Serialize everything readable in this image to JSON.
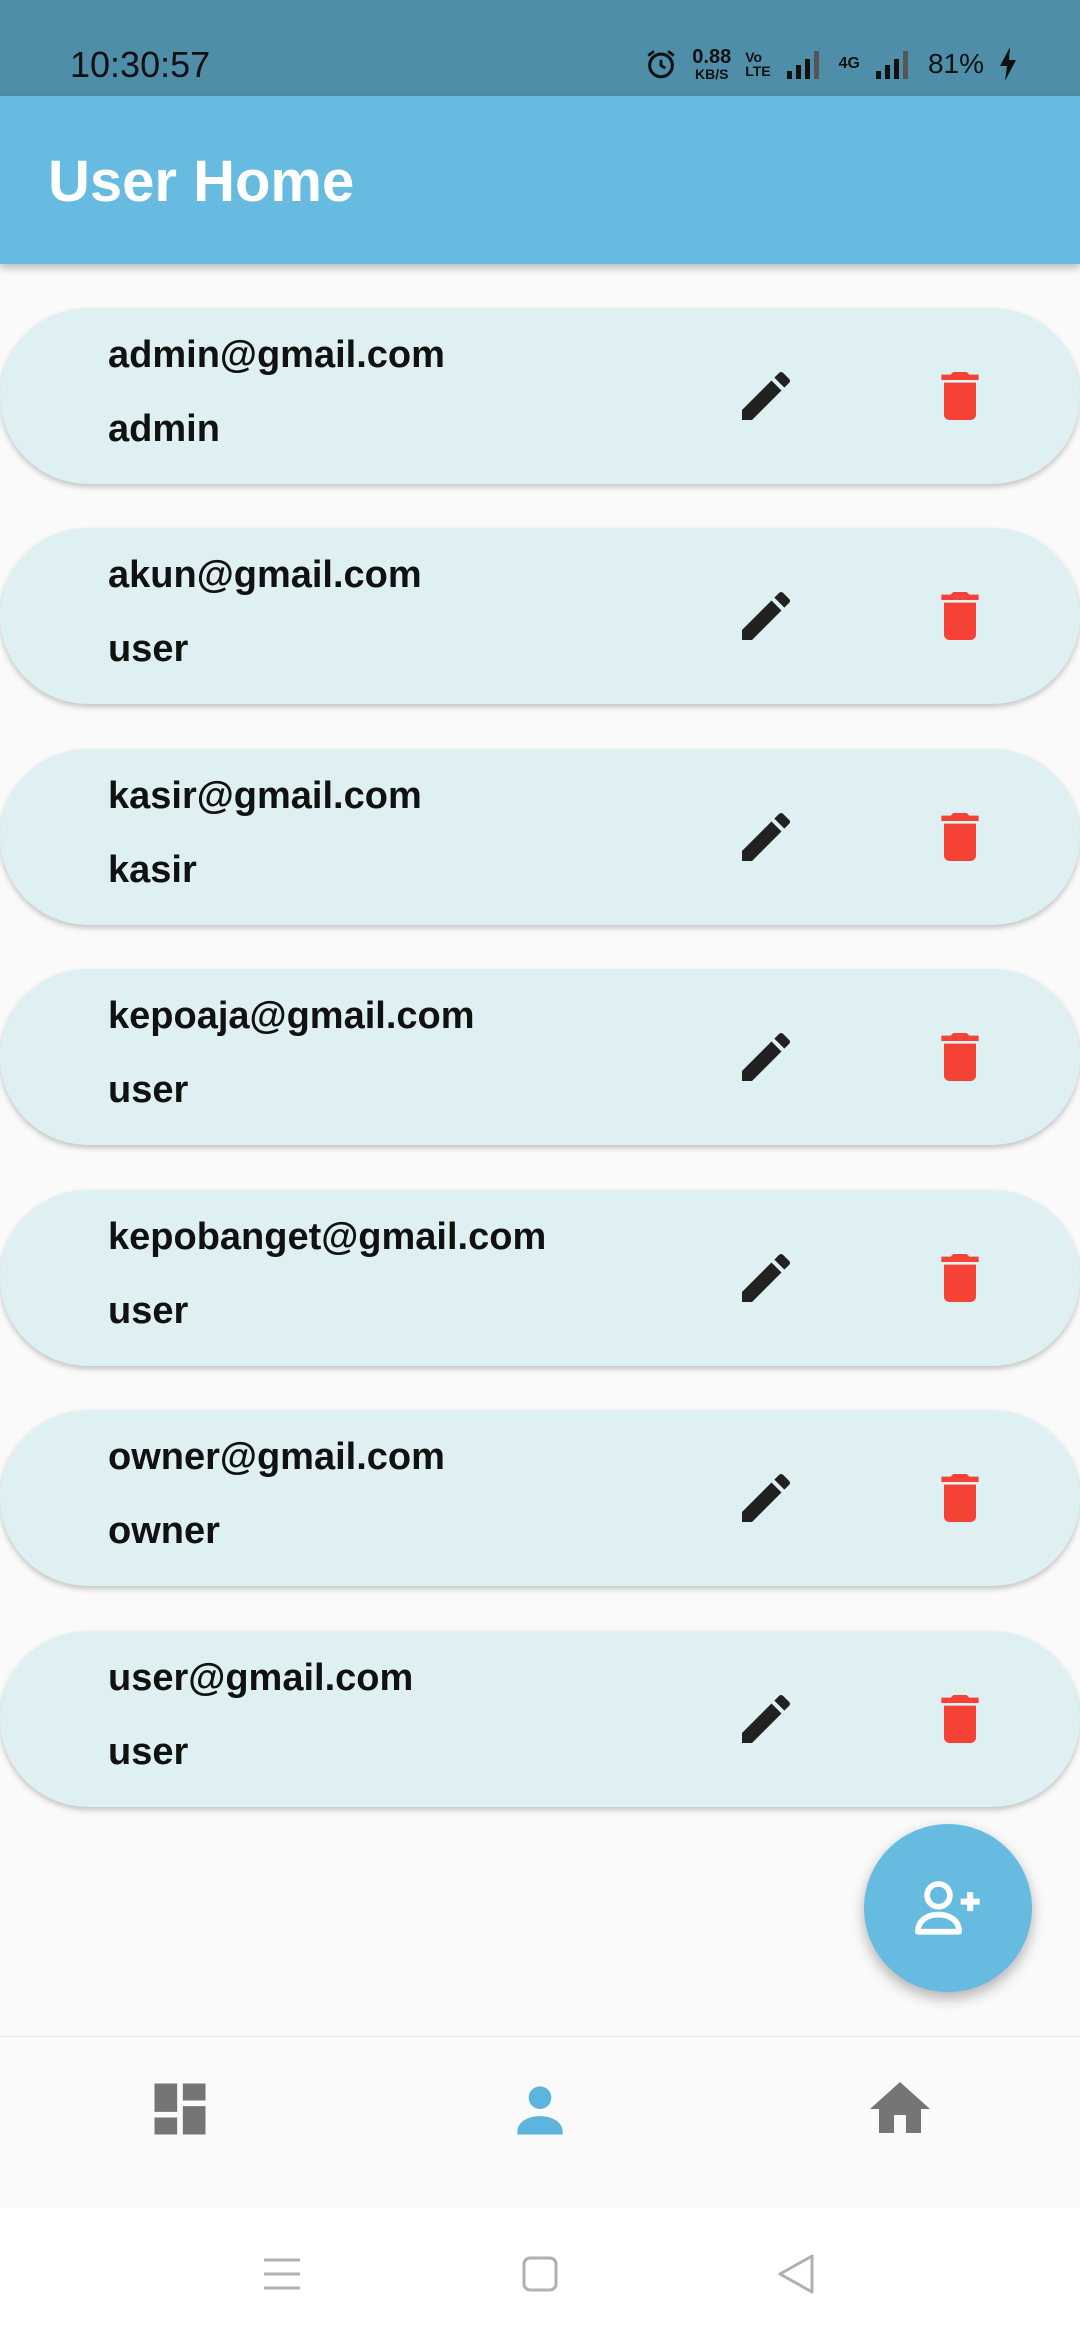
{
  "status_bar": {
    "time": "10:30:57",
    "net_speed_value": "0.88",
    "net_speed_unit": "KB/S",
    "volte_top": "Vo",
    "volte_bottom": "LTE",
    "network_type": "4G",
    "battery": "81%"
  },
  "app_bar": {
    "title": "User Home"
  },
  "users": [
    {
      "email": "admin@gmail.com",
      "role": "admin"
    },
    {
      "email": "akun@gmail.com",
      "role": "user"
    },
    {
      "email": "kasir@gmail.com",
      "role": "kasir"
    },
    {
      "email": "kepoaja@gmail.com",
      "role": "user"
    },
    {
      "email": "kepobanget@gmail.com",
      "role": "user"
    },
    {
      "email": "owner@gmail.com",
      "role": "owner"
    },
    {
      "email": "user@gmail.com",
      "role": "user"
    }
  ],
  "icons": {
    "edit": "pencil-icon",
    "delete": "trash-icon",
    "fab": "add-person-icon",
    "nav_dashboard": "dashboard-icon",
    "nav_users": "person-icon",
    "nav_home": "home-icon"
  },
  "colors": {
    "app_bar": "#67bbe0",
    "status_bar": "#4e8ea9",
    "card": "#def0f2",
    "delete": "#f44336",
    "nav_active": "#5db4dc",
    "nav_inactive": "#757575"
  },
  "bottom_nav": {
    "active_index": 1
  }
}
